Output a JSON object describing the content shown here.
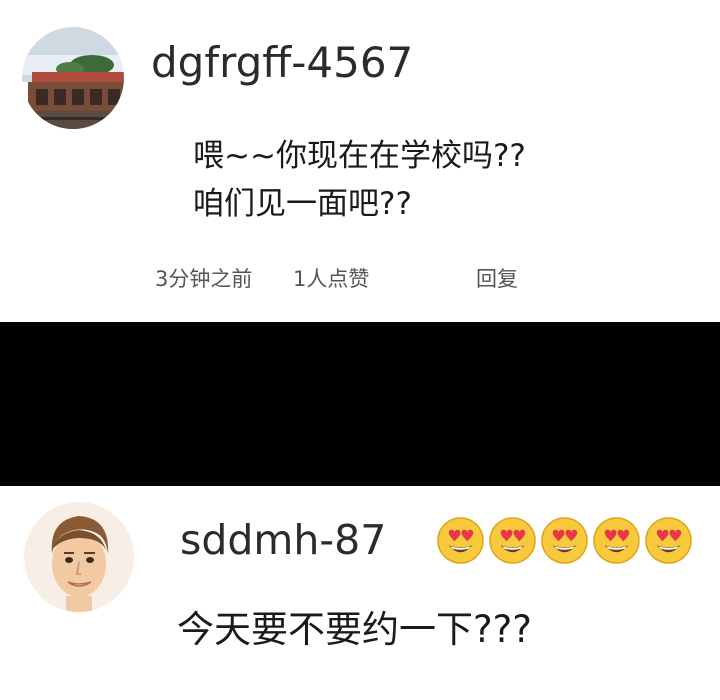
{
  "comment_1": {
    "username": "dgfrgff-4567",
    "text_line_1": "喂~~你现在在学校吗??",
    "text_line_2": "咱们见一面吧??",
    "time": "3分钟之前",
    "likes": "1人点赞",
    "reply_label": "回复"
  },
  "comment_2": {
    "username": "sddmh-87",
    "text": "今天要不要约一下???",
    "emojis": [
      "heart-eyes-emoji",
      "heart-eyes-emoji",
      "heart-eyes-emoji",
      "heart-eyes-emoji",
      "heart-eyes-emoji"
    ]
  },
  "colors": {
    "band": "#000000",
    "background": "#ffffff",
    "meta_text": "#555555"
  }
}
